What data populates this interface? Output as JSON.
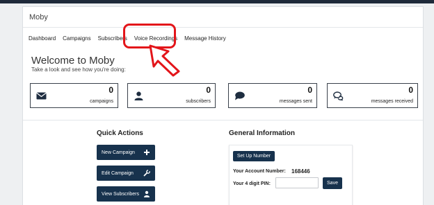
{
  "app": {
    "title": "Moby"
  },
  "nav": {
    "items": [
      {
        "label": "Dashboard"
      },
      {
        "label": "Campaigns"
      },
      {
        "label": "Subscribers"
      },
      {
        "label": "Voice Recordings"
      },
      {
        "label": "Message History"
      }
    ]
  },
  "welcome": {
    "title": "Welcome to Moby",
    "subtitle": "Take a look and see how you're doing:"
  },
  "stats": [
    {
      "value": "0",
      "label": "campaigns",
      "icon": "envelope-icon"
    },
    {
      "value": "0",
      "label": "subscribers",
      "icon": "user-icon"
    },
    {
      "value": "0",
      "label": "messages sent",
      "icon": "speech-bubble-icon"
    },
    {
      "value": "0",
      "label": "messages received",
      "icon": "chat-bubbles-icon"
    }
  ],
  "quick_actions": {
    "title": "Quick Actions",
    "buttons": [
      {
        "label": "New Campaign",
        "icon": "plus-icon"
      },
      {
        "label": "Edit Campaign",
        "icon": "wrench-icon"
      },
      {
        "label": "View Subscribers",
        "icon": "user-icon"
      }
    ]
  },
  "general_info": {
    "title": "General Information",
    "setup_button": "Set Up Number",
    "account_number_label": "Your Account Number:",
    "account_number": "168446",
    "pin_label": "Your 4 digit PIN:",
    "pin_value": "",
    "save_button": "Save"
  },
  "colors": {
    "primary": "#17324d",
    "highlight": "#e3151a",
    "topbar": "#1f2a3a"
  }
}
